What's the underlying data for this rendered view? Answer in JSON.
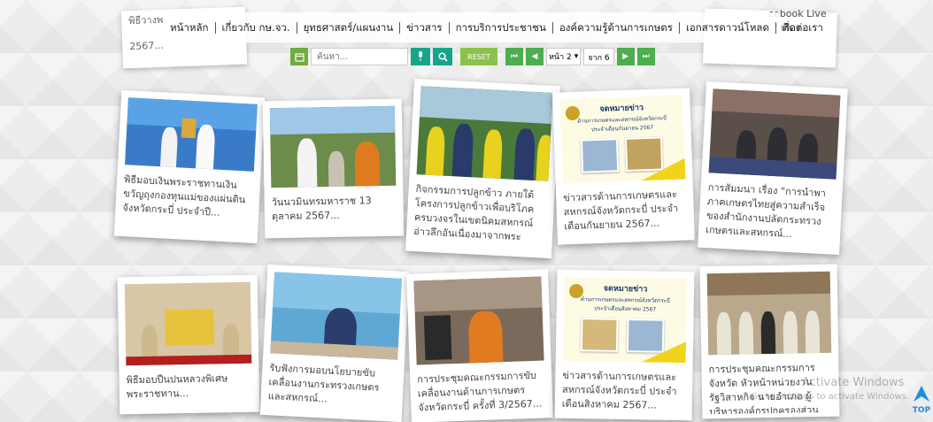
{
  "nav": {
    "items": [
      "หน้าหลัก",
      "เกี่ยวกับ กษ.จว.",
      "ยุทธศาสตร์/แผนงาน",
      "ข่าวสาร",
      "การบริการประชาชน",
      "องค์ความรู้ด้านการเกษตร",
      "เอกสารดาวน์โหลด",
      "ติดต่อเรา"
    ]
  },
  "peek": {
    "left_line1": "พิธีวางพ",
    "left_line2": "2567...",
    "right_line1": "cebook Live",
    "right_line2": "\" เรื่อง"
  },
  "toolbar": {
    "search_placeholder": "ค้นหา...",
    "reset_label": "RESET",
    "page_selected": "หน้า 2",
    "of_text": "จาก 6"
  },
  "cards": [
    {
      "caption": "พิธีมอบเงินพระราชทานเงินขวัญถุงกองทุนแม่ของแผ่นดิน จังหวัดกระบี่ ประจำปี..."
    },
    {
      "caption": "วันนวมินทรมหาราช 13 ตุลาคม 2567..."
    },
    {
      "caption": "กิจกรรมการปลูกข้าว ภายใต้โครงการปลูกข้าวเพื่อบริโภคครบวงจรในเขตนิคมสหกรณ์อ่าวลึกอันเนื่องมาจากพระราชดำริ..."
    },
    {
      "caption": "ข่าวสารด้านการเกษตรและสหกรณ์จังหวัดกระบี่ ประจำเดือนกันยายน 2567...",
      "poster_title": "จดหมายข่าว",
      "poster_sub": "ด้านการเกษตรและสหกรณ์จังหวัดกระบี่",
      "poster_month": "ประจำเดือนกันยายน 2567"
    },
    {
      "caption": "การสัมมนา เรื่อง \"การนำพาภาคเกษตรไทยสู่ความสำเร็จ ของสำนักงานปลัดกระทรวงเกษตรและสหกรณ์..."
    },
    {
      "caption": "พิธีมอบปืนปนหลวงพิเศษพระราชทาน..."
    },
    {
      "caption": "รับฟังการมอบนโยบายขับเคลื่อนงานกระทรวงเกษตรและสหกรณ์..."
    },
    {
      "caption": "การประชุมคณะกรรมการขับเคลื่อนงานด้านการเกษตรจังหวัดกระบี่ ครั้งที่ 3/2567..."
    },
    {
      "caption": "ข่าวสารด้านการเกษตรและสหกรณ์จังหวัดกระบี่ ประจำเดือนสิงหาคม 2567...",
      "poster_title": "จดหมายข่าว",
      "poster_sub": "ด้านการเกษตรและสหกรณ์จังหวัดกระบี่",
      "poster_month": "ประจำเดือนสิงหาคม 2567"
    },
    {
      "caption": "การประชุมคณะกรรมการจังหวัด หัวหน้าหน่วยงานรัฐวิสาหกิจ นายอำเภอ ผู้บริหารองค์กรปกครองส่วนท้องถิ่น..."
    }
  ],
  "watermark": {
    "line1": "Activate Windows",
    "line2": "Go to Settings to activate Windows."
  },
  "top_label": "TOP",
  "colors": {
    "green": "#6fae3d",
    "teal": "#17a589",
    "poster_yellow": "#f2d31b",
    "poster_blue": "#1c3a6e"
  }
}
